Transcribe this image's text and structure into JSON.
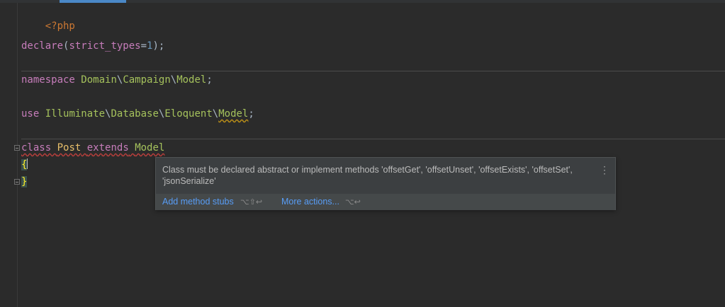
{
  "code": {
    "php_open": "<?php",
    "declare_fn": "declare",
    "declare_open": "(",
    "declare_key": "strict_types",
    "declare_eq": "=",
    "declare_val": "1",
    "declare_close": ");",
    "ns_kw": "namespace",
    "ns_seg1": "Domain",
    "ns_seg2": "Campaign",
    "ns_seg3": "Model",
    "use_kw": "use",
    "use_seg1": "Illuminate",
    "use_seg2": "Database",
    "use_seg3": "Eloquent",
    "use_seg4": "Model",
    "backslash": "\\",
    "semicolon": ";",
    "class_kw": "class",
    "class_name": "Post",
    "extends_kw": "extends",
    "parent_class": "Model",
    "brace_open": "{",
    "brace_close": "}"
  },
  "popup": {
    "message": "Class must be declared abstract or implement methods 'offsetGet', 'offsetUnset', 'offsetExists', 'offsetSet', 'jsonSerialize'",
    "menu_glyph": "⋮",
    "actions": [
      {
        "label": "Add method stubs",
        "shortcut": "⌥⇧↩"
      },
      {
        "label": "More actions...",
        "shortcut": "⌥↩"
      }
    ]
  },
  "colors": {
    "background": "#2b2b2b",
    "keyword": "#cc7832",
    "namespace": "#a5c25c",
    "number": "#6897bb",
    "class_name": "#e8bf6a",
    "link": "#589df6",
    "tab_indicator": "#4a88c7"
  }
}
